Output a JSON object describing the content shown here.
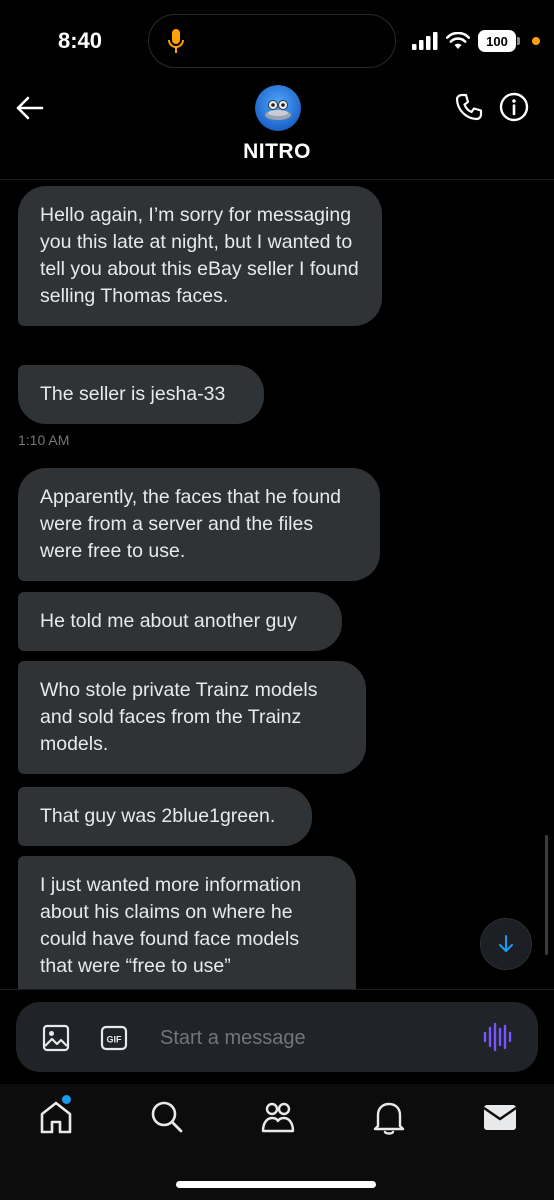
{
  "status_bar": {
    "time": "8:40",
    "battery": "100",
    "icons": [
      "microphone-icon",
      "signal-icon",
      "wifi-icon",
      "battery-icon"
    ]
  },
  "header": {
    "contact_name": "NITRO",
    "icons": [
      "back-arrow-icon",
      "phone-icon",
      "info-icon"
    ]
  },
  "messages": [
    {
      "text": "Hello again, I’m sorry for messaging you this late at night, but I wanted to tell you about this eBay seller I found selling Thomas faces."
    },
    {
      "text": "The seller is jesha-33"
    },
    {
      "text": "Apparently, the faces that he found were from a server and the files were free to use."
    },
    {
      "text": "He told me about another guy"
    },
    {
      "text": "Who stole private Trainz models and sold faces from the Trainz models."
    },
    {
      "text": "That guy was 2blue1green."
    },
    {
      "text": "I just wanted more information about his claims on where he could have found face models that were “free to use”"
    }
  ],
  "timestamps": [
    "1:10 AM"
  ],
  "composer": {
    "placeholder": "Start a message",
    "icons": [
      "image-icon",
      "gif-icon",
      "voice-icon"
    ]
  },
  "nav": {
    "items": [
      "home-icon",
      "search-icon",
      "communities-icon",
      "notifications-icon",
      "messages-icon"
    ]
  },
  "colors": {
    "bubble": "#2f3336",
    "accent_blue": "#1d9bf0",
    "voice_purple": "#7856ff",
    "mic_orange": "#ff9f0a"
  }
}
